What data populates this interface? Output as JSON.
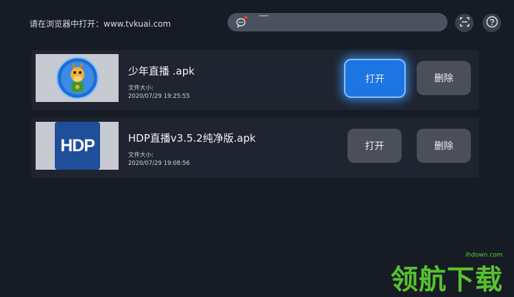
{
  "header": {
    "hint_text": "请在浏览器中打开：www.tvkuai.com",
    "search_placeholder": ""
  },
  "apps": [
    {
      "title": "少年直播  .apk",
      "size_label": "文件大小:",
      "date": "2020/07/29 19:25:55",
      "open_label": "打开",
      "delete_label": "删除",
      "focused": true
    },
    {
      "title": "HDP直播v3.5.2纯净版.apk",
      "size_label": "文件大小:",
      "date": "2020/07/29 19:08:56",
      "open_label": "打开",
      "delete_label": "删除",
      "focused": false,
      "logo_text": "HDP"
    }
  ],
  "watermark": {
    "site": "ihdown.com",
    "brand": "领航下载"
  },
  "colors": {
    "background": "#171b24",
    "card": "#1f2430",
    "focus_accent": "#1d74e3",
    "button": "#4a4f5a",
    "watermark": "#57c12f"
  },
  "icons": [
    "chat-bubble-icon",
    "scan-icon",
    "help-icon"
  ]
}
